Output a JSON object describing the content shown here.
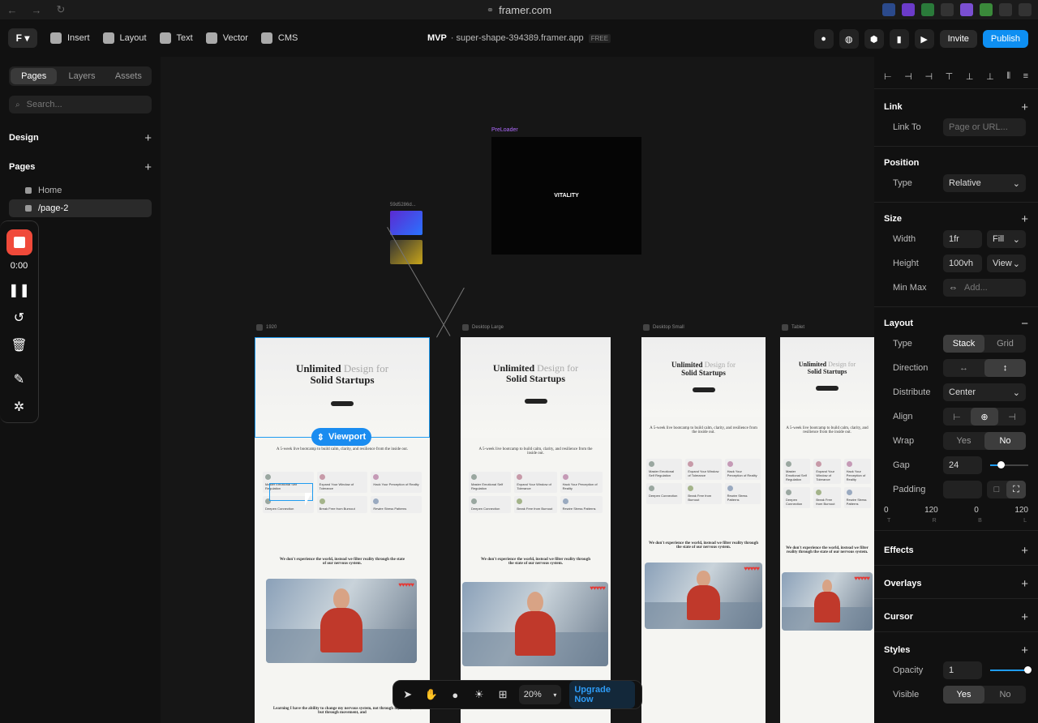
{
  "browser": {
    "url": "framer.com"
  },
  "toolbar": {
    "insert": "Insert",
    "layout": "Layout",
    "text": "Text",
    "vector": "Vector",
    "cms": "CMS",
    "project_name": "MVP",
    "project_sub": "· super-shape-394389.framer.app",
    "badge": "FREE",
    "invite": "Invite",
    "publish": "Publish"
  },
  "left": {
    "tabs": [
      "Pages",
      "Layers",
      "Assets"
    ],
    "search_placeholder": "Search...",
    "design": "Design",
    "pages": "Pages",
    "page_items": [
      "Home",
      "/page-2"
    ]
  },
  "recorder": {
    "time": "0:00"
  },
  "canvas": {
    "preloader_label": "PreLoader",
    "preloader_text": "VITALITY",
    "thumb_label": "59d5286d...",
    "frames": [
      {
        "label": "1920"
      },
      {
        "label": "Desktop Large"
      },
      {
        "label": "Desktop Small"
      },
      {
        "label": "Tablet"
      }
    ],
    "hero_title_1": "Unlimited",
    "hero_title_light": "Design for",
    "hero_title_2": "Solid Startups",
    "subhead": "A 5-week live bootcamp to build calm, clarity, and resilience from the inside out.",
    "subhead2": "We don't experience the world, instead we filter reality through the state of our nervous system.",
    "subhead3": "Learning I have the ability to change my nervous system, not through my brain, but through movement, and",
    "cards": [
      "Master Emotional Self Regulation",
      "Expand Your Window of Tolerance",
      "Hack Your Perception of Reality",
      "Deepen Connection",
      "Break Free from Burnout",
      "Rewire Stress Patterns"
    ],
    "viewport_label": "Viewport"
  },
  "bottom_bar": {
    "zoom": "20%",
    "upgrade": "Upgrade Now"
  },
  "right": {
    "link": "Link",
    "link_to": "Link To",
    "link_placeholder": "Page or URL...",
    "position": "Position",
    "type": "Type",
    "type_value": "Relative",
    "size": "Size",
    "width": "Width",
    "width_value": "1fr",
    "width_mode": "Fill",
    "height": "Height",
    "height_value": "100vh",
    "height_mode": "View",
    "minmax": "Min Max",
    "minmax_placeholder": "Add...",
    "layout": "Layout",
    "layout_type_stack": "Stack",
    "layout_type_grid": "Grid",
    "direction": "Direction",
    "distribute": "Distribute",
    "distribute_value": "Center",
    "align": "Align",
    "wrap": "Wrap",
    "wrap_yes": "Yes",
    "wrap_no": "No",
    "gap": "Gap",
    "gap_value": "24",
    "gap_slider": 0.28,
    "padding": "Padding",
    "pad_vals": [
      "0",
      "120",
      "0",
      "120"
    ],
    "pad_lbls": [
      "T",
      "R",
      "B",
      "L"
    ],
    "effects": "Effects",
    "overlays": "Overlays",
    "cursor": "Cursor",
    "styles": "Styles",
    "opacity": "Opacity",
    "opacity_value": "1",
    "visible": "Visible",
    "visible_yes": "Yes",
    "visible_no": "No"
  },
  "colors": {
    "accent": "#0e8ff2",
    "record": "#f04a3a",
    "preloader_label": "#b06bff"
  }
}
